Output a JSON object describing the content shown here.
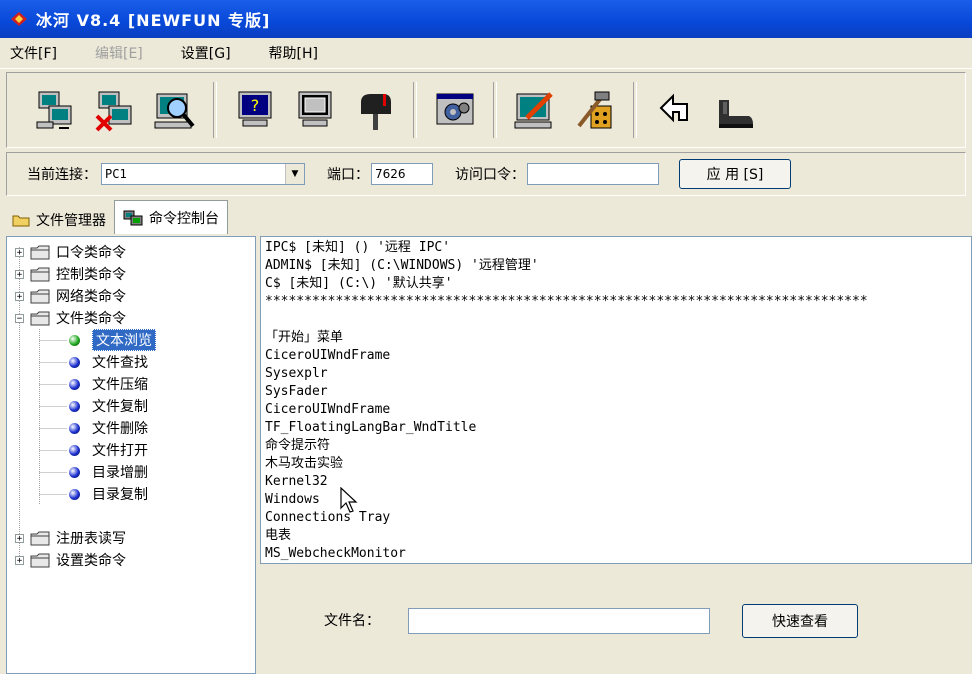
{
  "window": {
    "title": "冰河 V8.4 [NEWFUN 专版]"
  },
  "menu": [
    {
      "label": "文件[F]",
      "disabled": false
    },
    {
      "label": "编辑[E]",
      "disabled": true
    },
    {
      "label": "设置[G]",
      "disabled": false
    },
    {
      "label": "帮助[H]",
      "disabled": false
    }
  ],
  "toolbar_icons": [
    "add-host-icon",
    "delete-host-icon",
    "search-host-icon",
    "help-icon",
    "capture-screen-icon",
    "mailbox-icon",
    "settings-icon",
    "edit-server-icon",
    "tools-icon",
    "back-icon",
    "exit-icon"
  ],
  "connection": {
    "current_label": "当前连接：",
    "current_value": "PC1",
    "port_label": "端口：",
    "port_value": "7626",
    "password_label": "访问口令：",
    "password_value": "",
    "apply_label": "应 用 [S]"
  },
  "tabs": [
    {
      "label": "文件管理器",
      "active": false
    },
    {
      "label": "命令控制台",
      "active": true
    }
  ],
  "tree": {
    "groups": [
      "口令类命令",
      "控制类命令",
      "网络类命令",
      "文件类命令",
      "注册表读写",
      "设置类命令"
    ],
    "file_children": [
      "文本浏览",
      "文件查找",
      "文件压缩",
      "文件复制",
      "文件删除",
      "文件打开",
      "目录增删",
      "目录复制"
    ],
    "selected": "文本浏览"
  },
  "console": {
    "lines": [
      "IPC$ [未知] () '远程 IPC'",
      "ADMIN$ [未知] (C:\\WINDOWS) '远程管理'",
      "C$ [未知] (C:\\) '默认共享'",
      "*****************************************************************************",
      "",
      "「开始」菜单",
      "CiceroUIWndFrame",
      "Sysexplr",
      "SysFader",
      "CiceroUIWndFrame",
      "TF_FloatingLangBar_WndTitle",
      "命令提示符",
      "木马攻击实验",
      "Kernel32",
      "Windows",
      "Connections Tray",
      "电表",
      "MS_WebcheckMonitor"
    ]
  },
  "filebar": {
    "label": "文件名：",
    "value": "",
    "button": "快速查看"
  },
  "colors": {
    "titlebar": "#0848d8",
    "selection": "#316ac5",
    "green_bullet": "#22aa22",
    "blue_bullet": "#1a2fd0"
  }
}
